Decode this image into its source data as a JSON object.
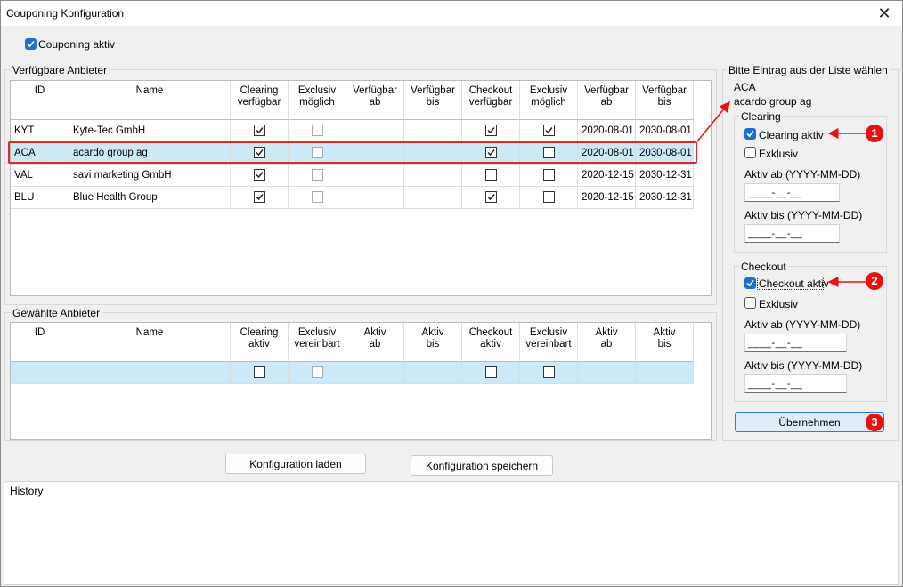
{
  "window": {
    "title": "Couponing Konfiguration",
    "close_glyph": "✕"
  },
  "couponing_active": {
    "label": "Couponing aktiv",
    "checked": true
  },
  "available": {
    "group_title": "Verfügbare Anbieter",
    "headers": [
      [
        "ID"
      ],
      [
        "Name"
      ],
      [
        "Clearing",
        "verfügbar"
      ],
      [
        "Exclusiv",
        "möglich"
      ],
      [
        "Verfügbar",
        "ab"
      ],
      [
        "Verfügbar",
        "bis"
      ],
      [
        "Checkout",
        "verfügbar"
      ],
      [
        "Exclusiv",
        "möglich"
      ],
      [
        "Verfügbar",
        "ab"
      ],
      [
        "Verfügbar",
        "bis"
      ]
    ],
    "rows": [
      {
        "id": "KYT",
        "name": "Kyte-Tec GmbH",
        "clearing": true,
        "excl1": false,
        "ab1": "",
        "bis1": "",
        "checkout": true,
        "excl2": true,
        "ab2": "2020-08-01",
        "bis2": "2030-08-01",
        "selected": false
      },
      {
        "id": "ACA",
        "name": "acardo group ag",
        "clearing": true,
        "excl1": false,
        "ab1": "",
        "bis1": "",
        "checkout": true,
        "excl2": false,
        "ab2": "2020-08-01",
        "bis2": "2030-08-01",
        "selected": true
      },
      {
        "id": "VAL",
        "name": "savi marketing GmbH",
        "clearing": true,
        "excl1": false,
        "ab1": "",
        "bis1": "",
        "checkout": false,
        "excl2": false,
        "ab2": "2020-12-15",
        "bis2": "2030-12-31",
        "selected": false
      },
      {
        "id": "BLU",
        "name": "Blue Health Group",
        "clearing": true,
        "excl1": false,
        "ab1": "",
        "bis1": "",
        "checkout": true,
        "excl2": false,
        "ab2": "2020-12-15",
        "bis2": "2030-12-31",
        "selected": false
      }
    ]
  },
  "chosen": {
    "group_title": "Gewählte Anbieter",
    "headers": [
      [
        "ID"
      ],
      [
        "Name"
      ],
      [
        "Clearing",
        "aktiv"
      ],
      [
        "Exclusiv",
        "vereinbart"
      ],
      [
        "Aktiv",
        "ab"
      ],
      [
        "Aktiv",
        "bis"
      ],
      [
        "Checkout",
        "aktiv"
      ],
      [
        "Exclusiv",
        "vereinbart"
      ],
      [
        "Aktiv",
        "ab"
      ],
      [
        "Aktiv",
        "bis"
      ]
    ],
    "rows": [
      {
        "id": "",
        "name": "",
        "clearing": false,
        "excl1": false,
        "ab1": "",
        "bis1": "",
        "checkout": false,
        "excl2": false,
        "ab2": "",
        "bis2": "",
        "selected": true
      }
    ]
  },
  "detail": {
    "group_title": "Bitte Eintrag aus der Liste wählen",
    "selected_id": "ACA",
    "selected_name": "acardo group ag",
    "clearing": {
      "title": "Clearing",
      "active_label": "Clearing aktiv",
      "active_checked": true,
      "exclusive_label": "Exklusiv",
      "exclusive_checked": false,
      "from_label": "Aktiv ab (YYYY-MM-DD)",
      "from_value": "____-__-__",
      "to_label": "Aktiv bis (YYYY-MM-DD)",
      "to_value": "____-__-__"
    },
    "checkout": {
      "title": "Checkout",
      "active_label": "Checkout aktiv",
      "active_checked": true,
      "exclusive_label": "Exklusiv",
      "exclusive_checked": false,
      "from_label": "Aktiv ab (YYYY-MM-DD)",
      "from_value": "____-__-__",
      "to_label": "Aktiv bis (YYYY-MM-DD)",
      "to_value": "____-__-__"
    },
    "apply_label": "Übernehmen"
  },
  "buttons": {
    "load_label": "Konfiguration laden",
    "save_label": "Konfiguration speichern"
  },
  "history": {
    "label": "History"
  },
  "annotations": {
    "badge1": "1",
    "badge2": "2",
    "badge3": "3",
    "color": "#e81010"
  }
}
